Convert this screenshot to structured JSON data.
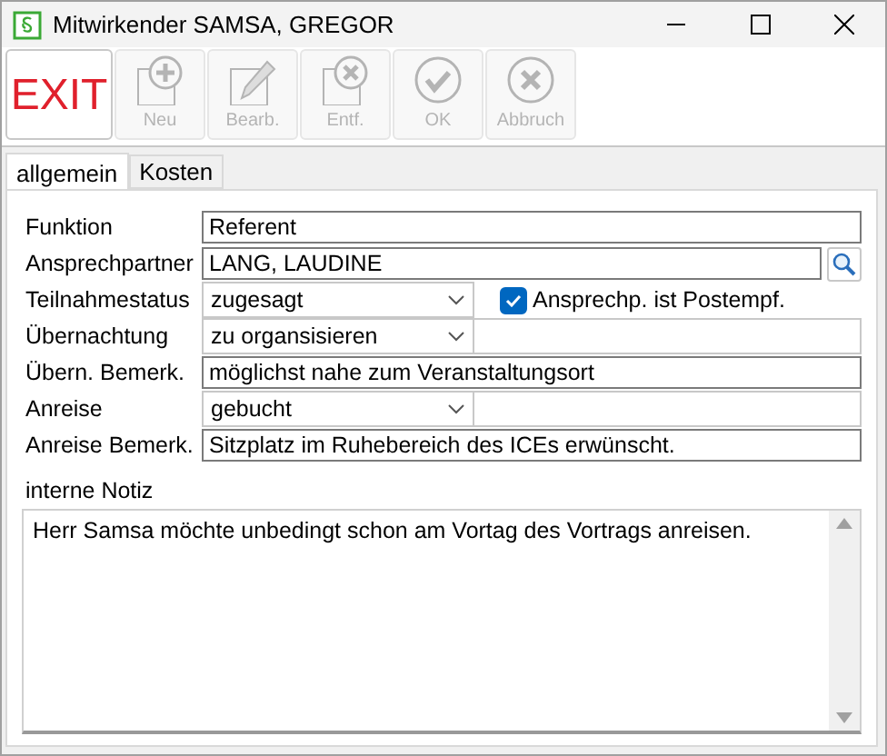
{
  "window": {
    "title": "Mitwirkender SAMSA, GREGOR"
  },
  "toolbar": [
    {
      "label": "EXIT",
      "kind": "exit",
      "disabled": false
    },
    {
      "label": "Neu",
      "kind": "new",
      "disabled": true
    },
    {
      "label": "Bearb.",
      "kind": "edit",
      "disabled": true
    },
    {
      "label": "Entf.",
      "kind": "delete",
      "disabled": true
    },
    {
      "label": "OK",
      "kind": "ok",
      "disabled": true
    },
    {
      "label": "Abbruch",
      "kind": "cancel",
      "disabled": true
    }
  ],
  "tabs": [
    {
      "label": "allgemein",
      "selected": true
    },
    {
      "label": "Kosten",
      "selected": false
    }
  ],
  "form": [
    {
      "label": "Funktion",
      "kind": "text",
      "value": "Referent"
    },
    {
      "label": "Ansprechpartner",
      "kind": "lookup",
      "value": "LANG, LAUDINE"
    },
    {
      "label": "Teilnahmestatus",
      "kind": "select",
      "value": "zugesagt",
      "checkbox": {
        "label": "Ansprechp. ist Postempf.",
        "checked": true
      }
    },
    {
      "label": "Übernachtung",
      "kind": "select",
      "value": "zu organsisieren"
    },
    {
      "label": "Übern. Bemerk.",
      "kind": "text",
      "value": "möglichst nahe zum Veranstaltungsort"
    },
    {
      "label": "Anreise",
      "kind": "select",
      "value": "gebucht"
    },
    {
      "label": "Anreise Bemerk.",
      "kind": "text",
      "value": "Sitzplatz im Ruhebereich des ICEs erwünscht."
    }
  ],
  "notes": {
    "label": "interne Notiz",
    "value": "Herr Samsa möchte unbedingt schon am Vortag des Vortrags anreisen."
  }
}
